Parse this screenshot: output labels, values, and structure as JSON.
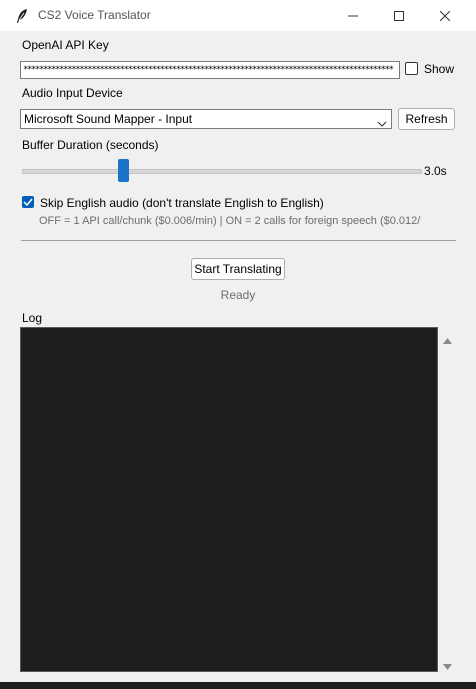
{
  "window": {
    "title": "CS2 Voice Translator"
  },
  "api_key": {
    "label": "OpenAI API Key",
    "value": "********************************************************************************************",
    "show_label": "Show",
    "show_checked": false
  },
  "audio": {
    "label": "Audio Input Device",
    "selected": "Microsoft Sound Mapper - Input",
    "refresh_label": "Refresh"
  },
  "buffer": {
    "label": "Buffer Duration (seconds)",
    "value_text": "3.0s",
    "value": 3.0
  },
  "skip_english": {
    "label": "Skip English audio (don't translate English to English)",
    "checked": true,
    "hint": "OFF = 1 API call/chunk ($0.006/min)  |  ON = 2 calls for foreign speech ($0.012/"
  },
  "controls": {
    "start_label": "Start Translating",
    "status": "Ready"
  },
  "log": {
    "label": "Log",
    "content": ""
  },
  "colors": {
    "accent": "#005fb8",
    "log_background": "#1e1e1e",
    "window_background": "#f0f0f0"
  }
}
